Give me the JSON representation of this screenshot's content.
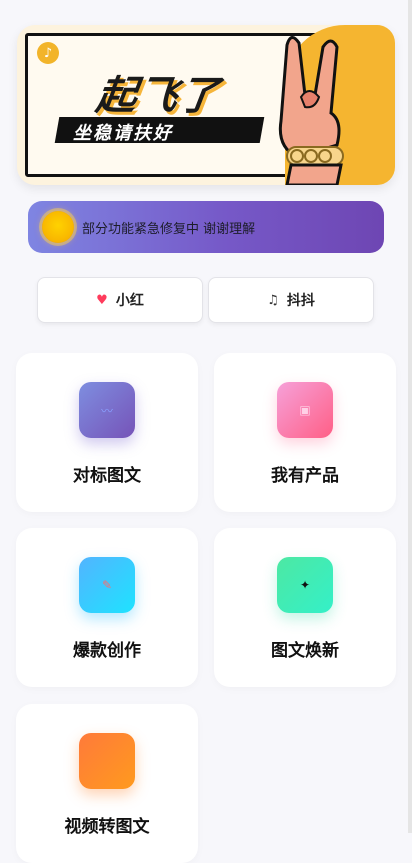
{
  "banner": {
    "title": "起飞了",
    "subtitle": "坐稳请扶好",
    "badge_icon": "music-note-icon"
  },
  "notice": {
    "text": "部分功能紧急修复中 谢谢理解",
    "icon": "sun-icon"
  },
  "tabs": [
    {
      "label": "小红",
      "icon": "heart-icon",
      "icon_color": "#ff3b5c"
    },
    {
      "label": "抖抖",
      "icon": "music-note-icon",
      "icon_color": "#333333"
    }
  ],
  "features": [
    {
      "label": "对标图文",
      "icon": "trend-chart-icon",
      "colors": [
        "#7e8ee0",
        "#7653b8"
      ]
    },
    {
      "label": "我有产品",
      "icon": "box-icon",
      "colors": [
        "#f6a1d9",
        "#ff5f86"
      ]
    },
    {
      "label": "爆款创作",
      "icon": "pencil-icon",
      "colors": [
        "#52b4ff",
        "#1ee3ff"
      ]
    },
    {
      "label": "图文焕新",
      "icon": "sparkle-icon",
      "colors": [
        "#4de8a3",
        "#34f0c8"
      ]
    },
    {
      "label": "视频转图文",
      "icon": "video-icon",
      "colors": [
        "#ff7a3a",
        "#ff9a1e"
      ]
    }
  ]
}
